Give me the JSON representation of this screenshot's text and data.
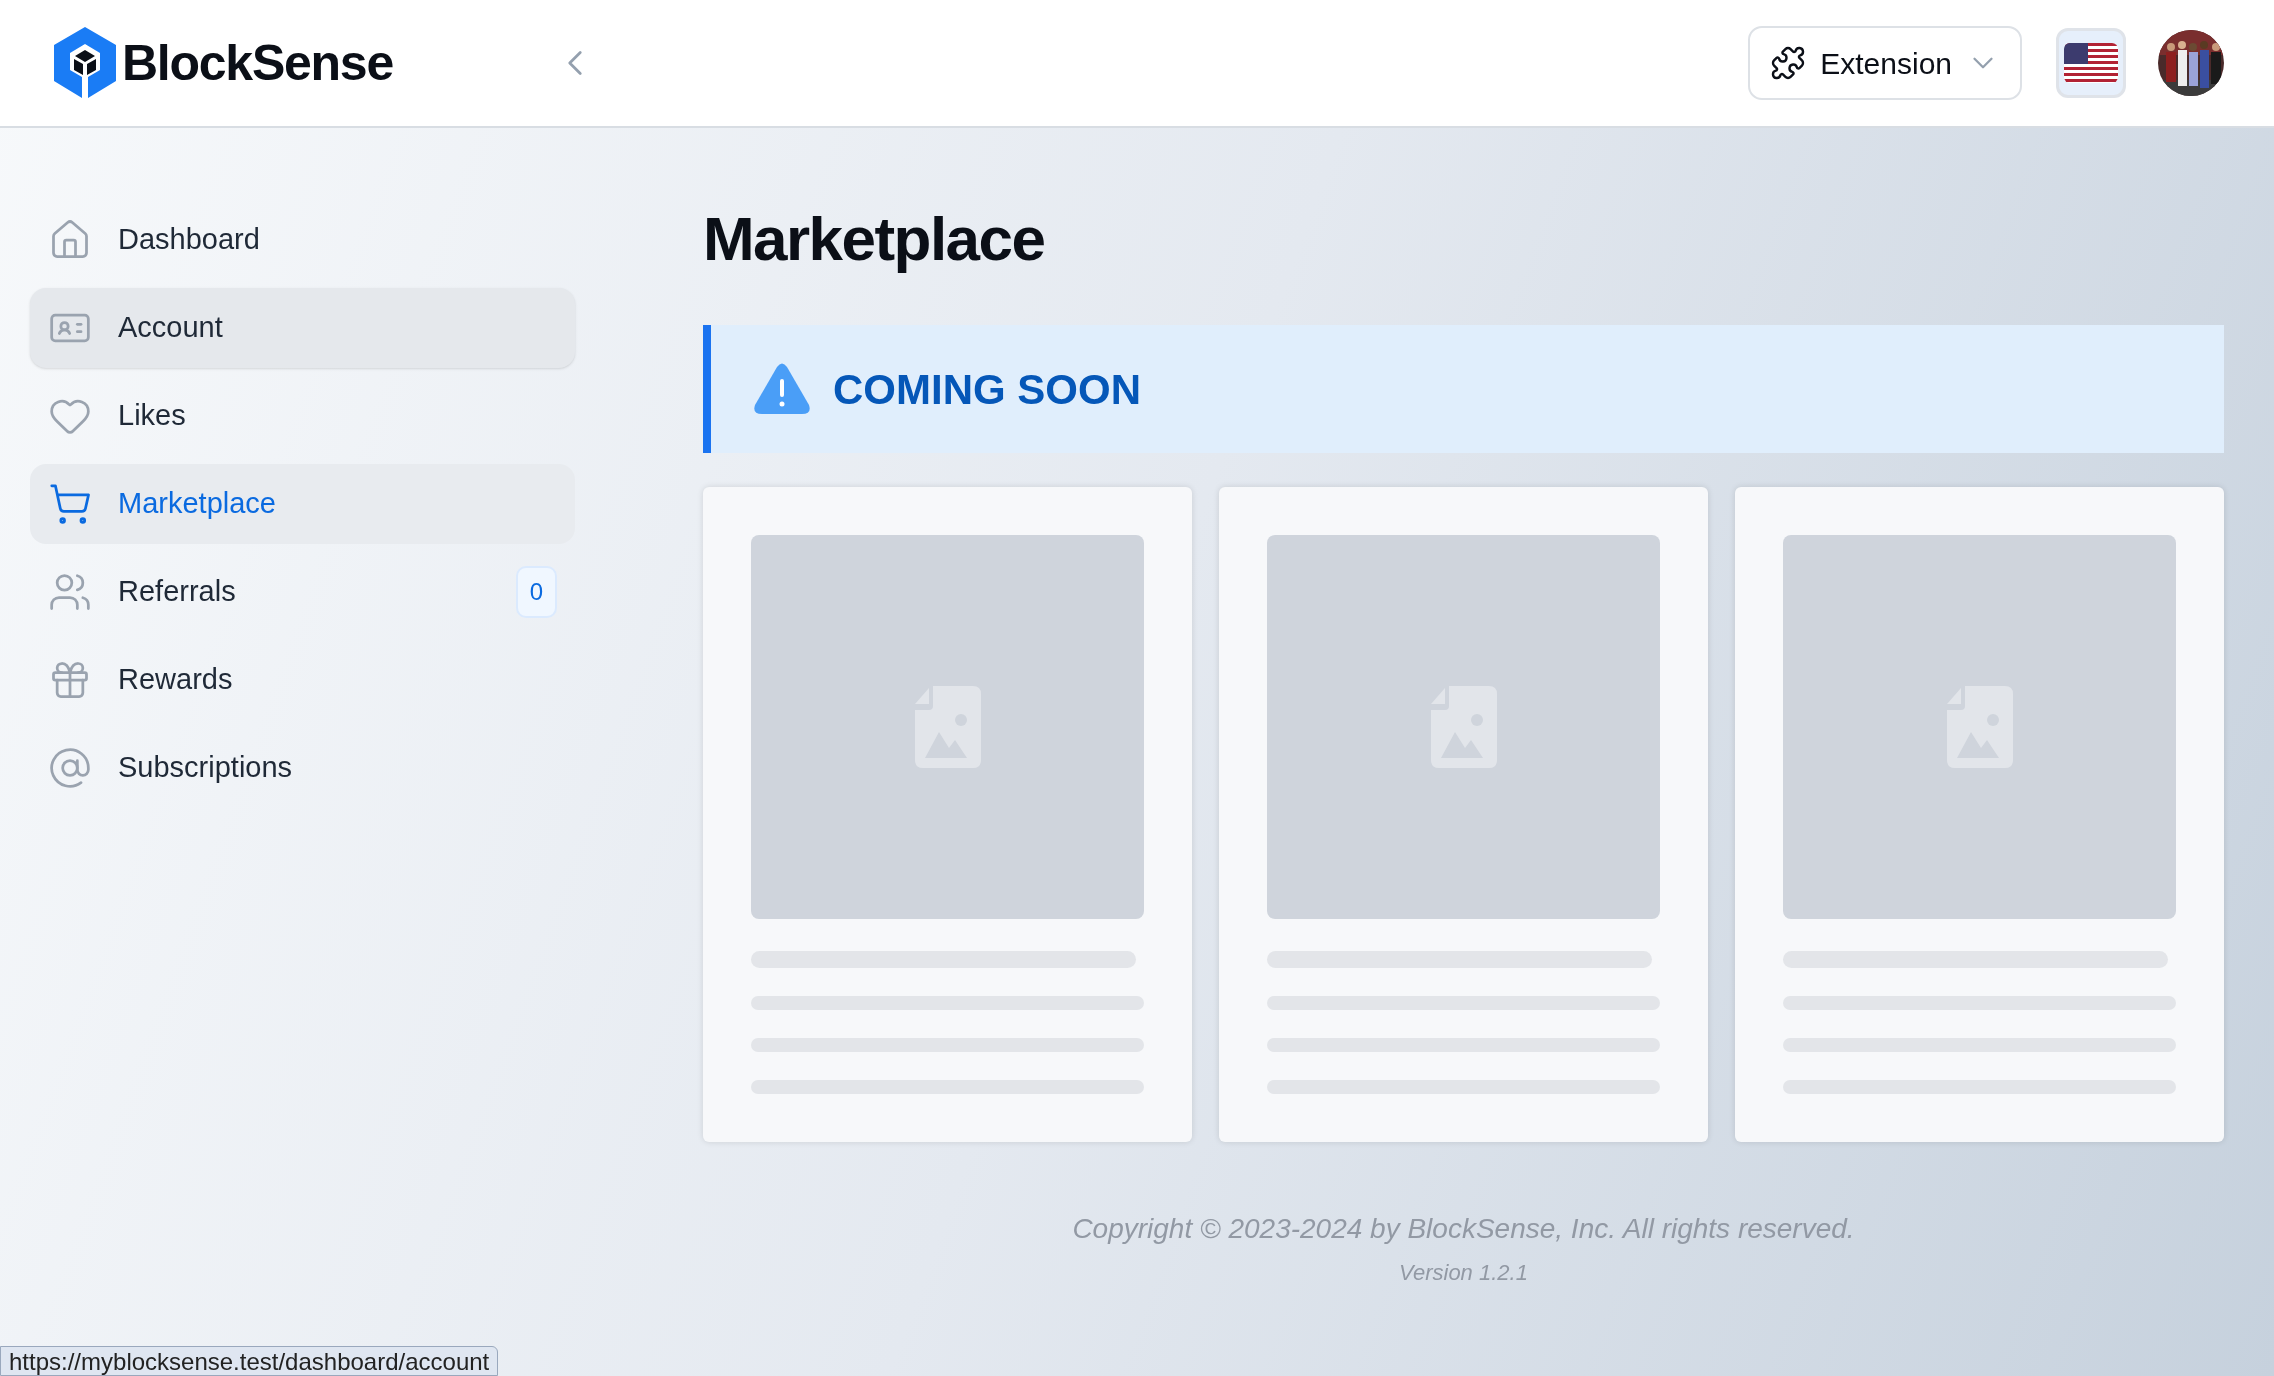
{
  "header": {
    "logo": "BlockSense",
    "extension_button": "Extension"
  },
  "sidebar": {
    "items": [
      {
        "label": "Dashboard",
        "selected": false,
        "hovered": false
      },
      {
        "label": "Account",
        "selected": false,
        "hovered": true
      },
      {
        "label": "Likes",
        "selected": false,
        "hovered": false
      },
      {
        "label": "Marketplace",
        "selected": true,
        "hovered": false
      },
      {
        "label": "Referrals",
        "selected": false,
        "hovered": false,
        "badge": "0"
      },
      {
        "label": "Rewards",
        "selected": false,
        "hovered": false
      },
      {
        "label": "Subscriptions",
        "selected": false,
        "hovered": false
      }
    ]
  },
  "page": {
    "title": "Marketplace",
    "alert": {
      "kind": "warning",
      "text": "COMING SOON"
    },
    "cards": [
      {
        "kind": "skeleton"
      },
      {
        "kind": "skeleton"
      },
      {
        "kind": "skeleton"
      }
    ]
  },
  "footer": {
    "copyright": "Copyright © 2023-2024 by BlockSense, Inc. All rights reserved.",
    "version": "Version 1.2.1"
  },
  "status_bar": "https://myblocksense.test/dashboard/account"
}
